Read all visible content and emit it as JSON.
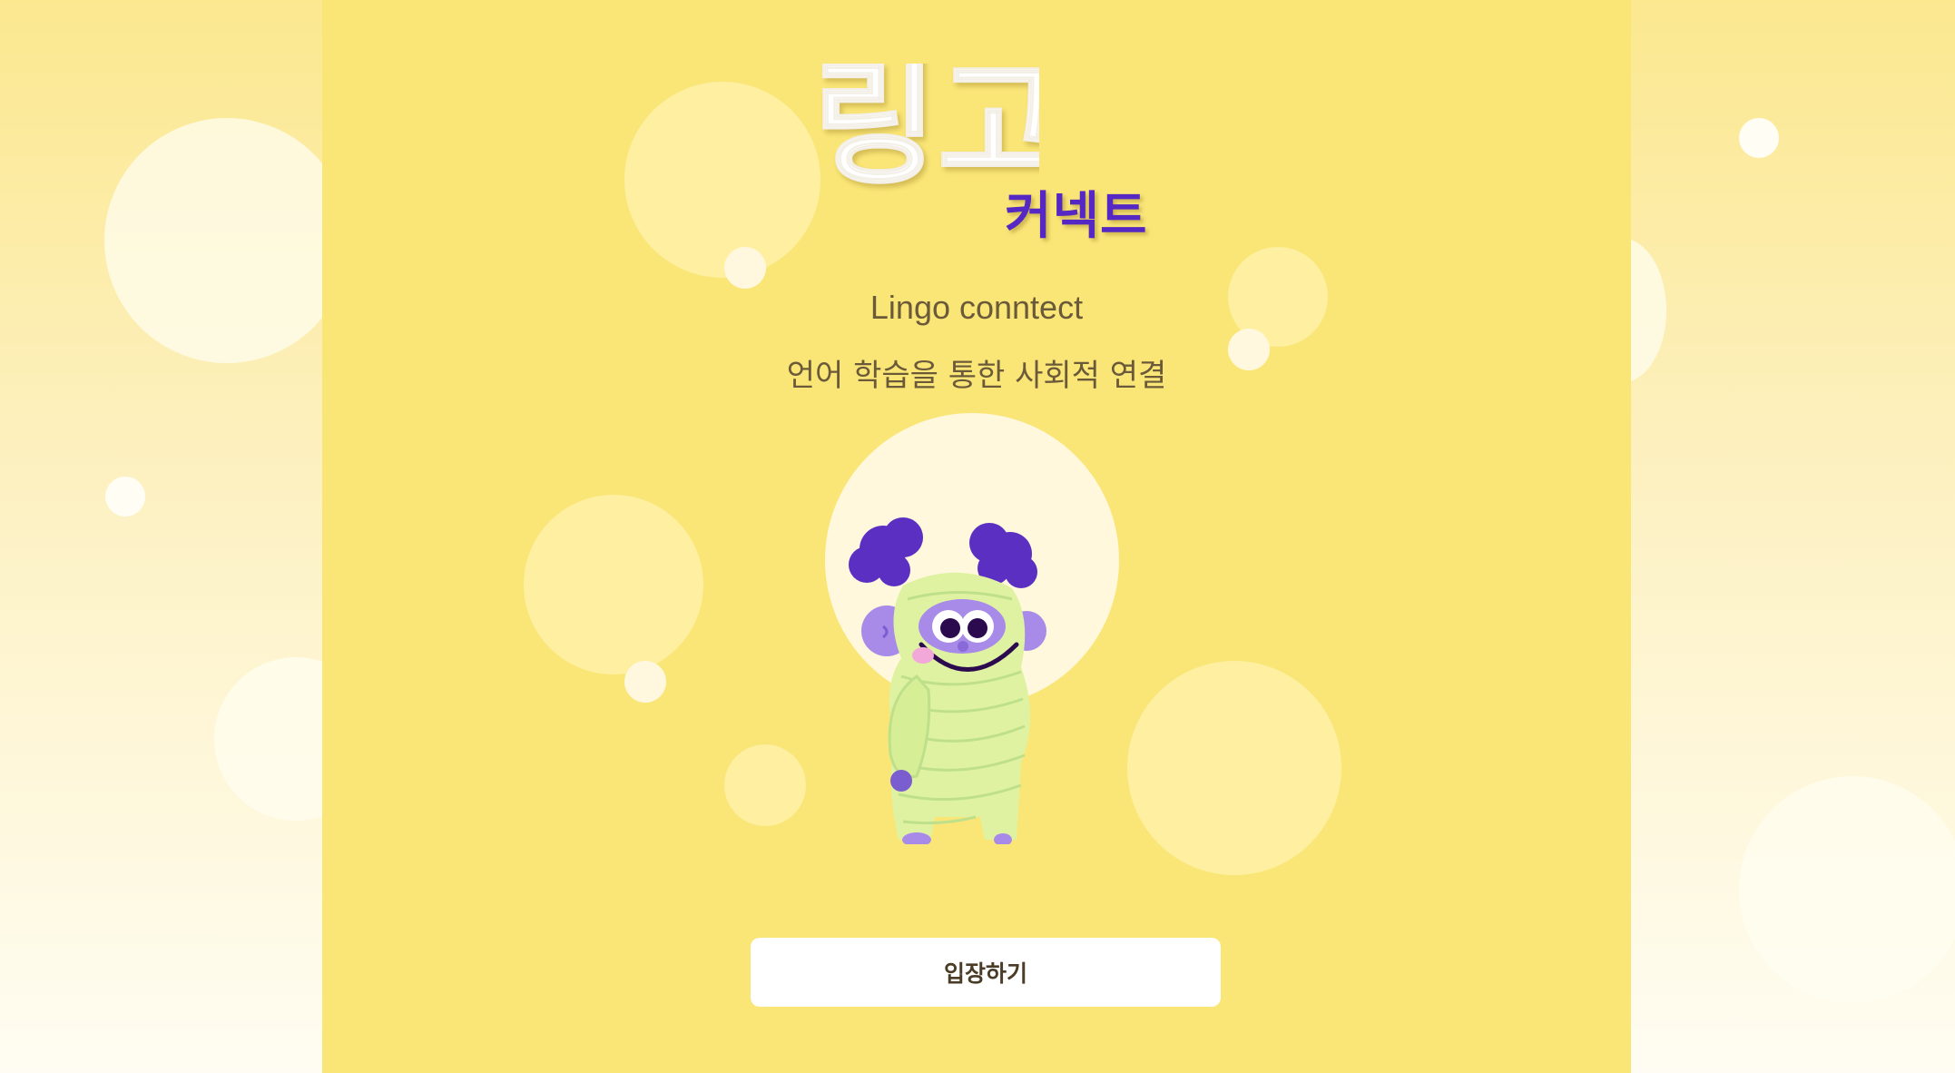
{
  "logo": {
    "main_text": "링고",
    "sub_text": "커넥트"
  },
  "subtitle": {
    "english": "Lingo conntect",
    "korean": "언어 학습을 통한 사회적 연결"
  },
  "mascot": {
    "icon": "mummy-monster-mascot"
  },
  "enter_button": {
    "label": "입장하기"
  },
  "colors": {
    "panel_background": "#fae677",
    "logo_text": "#ffffff",
    "logo_subtext": "#5528c4",
    "subtitle_text": "#6b5a3a",
    "button_background": "#ffffff"
  }
}
